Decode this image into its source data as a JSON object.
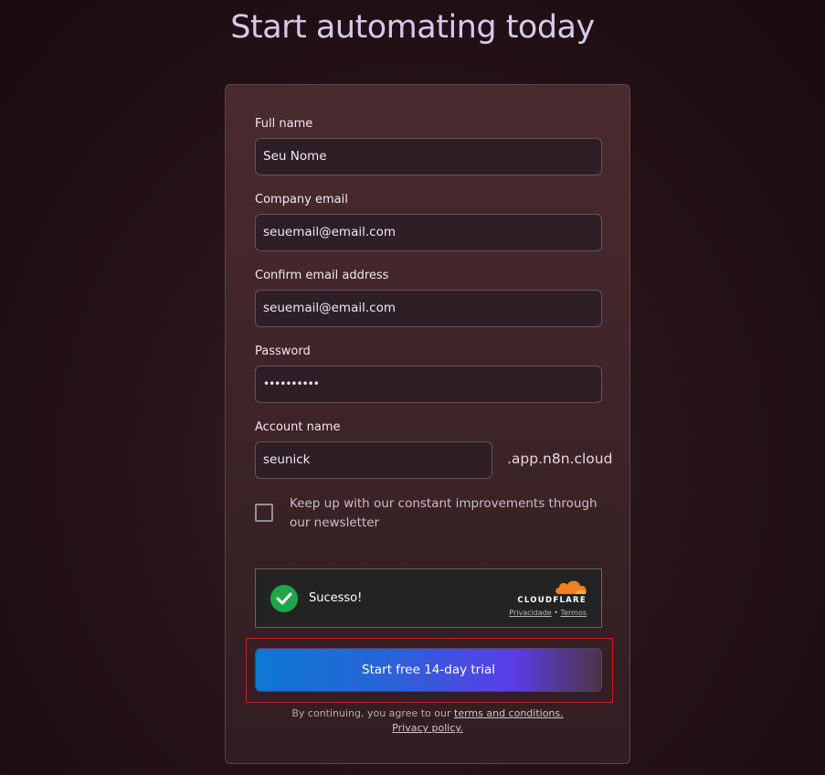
{
  "page": {
    "heading": "Start automating today"
  },
  "form": {
    "full_name": {
      "label": "Full name",
      "value": "Seu Nome"
    },
    "company_email": {
      "label": "Company email",
      "value": "seuemail@email.com"
    },
    "confirm_email": {
      "label": "Confirm email address",
      "value": "seuemail@email.com"
    },
    "password": {
      "label": "Password",
      "value": "••••••••••"
    },
    "account_name": {
      "label": "Account name",
      "value": "seunick",
      "suffix": ".app.n8n.cloud"
    },
    "newsletter": {
      "label": "Keep up with our constant improvements through our newsletter",
      "checked": false
    }
  },
  "captcha": {
    "status": "Sucesso!",
    "brand": "CLOUDFLARE",
    "privacy_link": "Privacidade",
    "separator": "•",
    "terms_link": "Termos",
    "brand_color": "#f38020",
    "success_color": "#1fa547"
  },
  "submit": {
    "label": "Start free 14-day trial"
  },
  "legal": {
    "prefix": "By continuing, you agree to our",
    "terms_link": "terms and conditions.",
    "privacy_link": "Privacy policy."
  }
}
